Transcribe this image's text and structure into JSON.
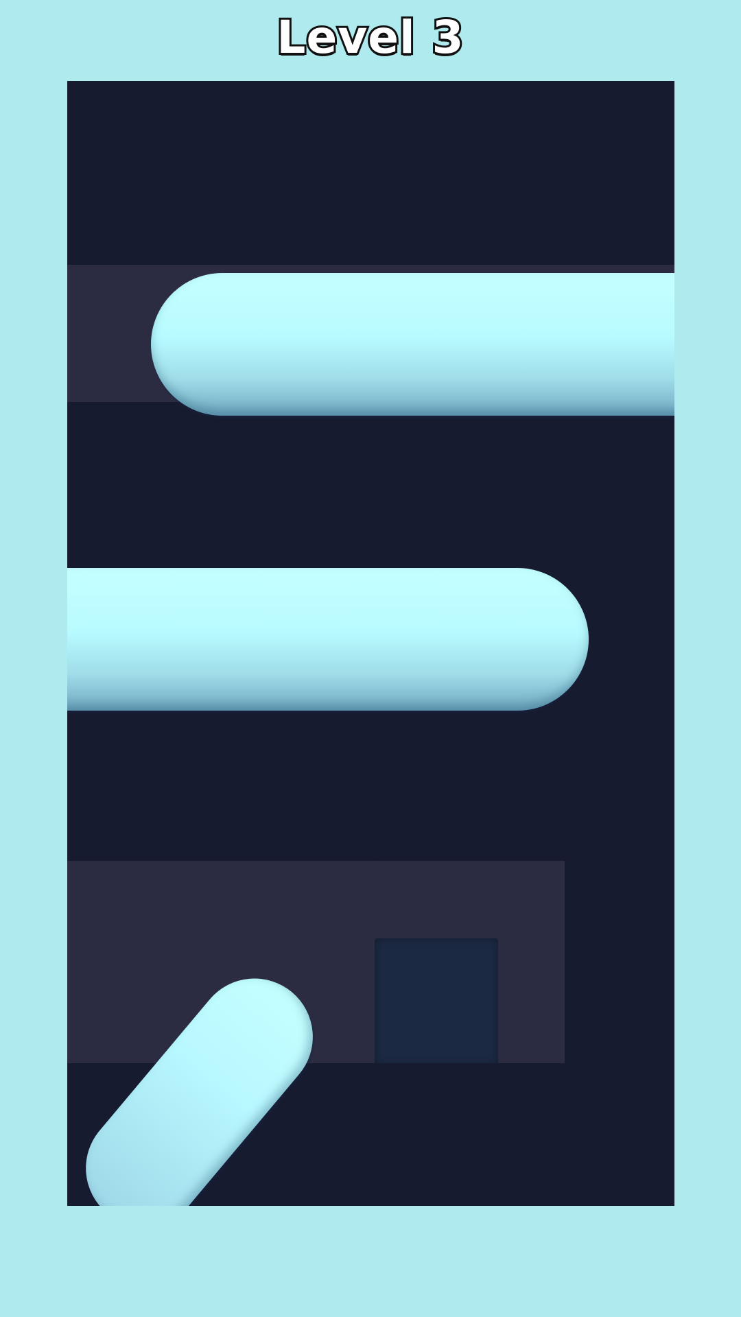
{
  "header": {
    "level_label": "Level 3"
  },
  "colors": {
    "background": "#aeeaee",
    "board": "#161b30",
    "slot": "#2b2b42",
    "piece": "#c4ffff"
  },
  "board": {
    "pieces": [
      {
        "name": "capsule-piece-top"
      },
      {
        "name": "capsule-piece-middle"
      },
      {
        "name": "capsule-piece-diagonal"
      }
    ]
  }
}
